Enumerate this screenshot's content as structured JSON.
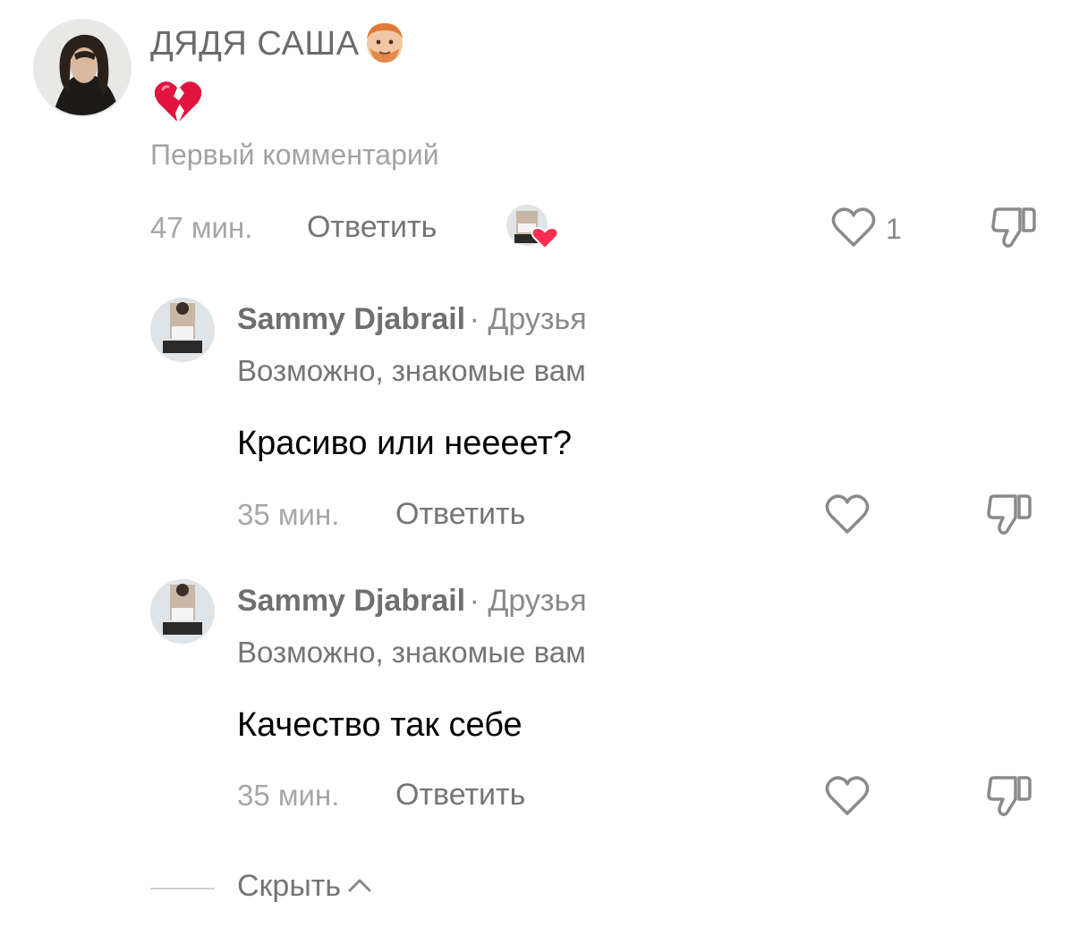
{
  "comment": {
    "author": "ДЯДЯ САША",
    "author_emoji_icon": "man-red-hair-face-icon",
    "text_emoji_icon": "broken-heart-icon",
    "tag": "Первый комментарий",
    "time": "47 мин.",
    "reply_label": "Ответить",
    "like_count": "1",
    "liked_by_creator_icon": "creator-avatar-heart-icon"
  },
  "replies": [
    {
      "author": "Sammy Djabrail",
      "separator": "·",
      "relation": "Друзья",
      "subline": "Возможно, знакомые вам",
      "text": "Красиво или неееет?",
      "time": "35 мин.",
      "reply_label": "Ответить"
    },
    {
      "author": "Sammy Djabrail",
      "separator": "·",
      "relation": "Друзья",
      "subline": "Возможно, знакомые вам",
      "text": "Качество так себе",
      "time": "35 мин.",
      "reply_label": "Ответить"
    }
  ],
  "hide_label": "Скрыть",
  "colors": {
    "heart_red": "#fe2c55",
    "broken_heart": "#e0143c",
    "icon_gray": "#8a8a8a"
  }
}
